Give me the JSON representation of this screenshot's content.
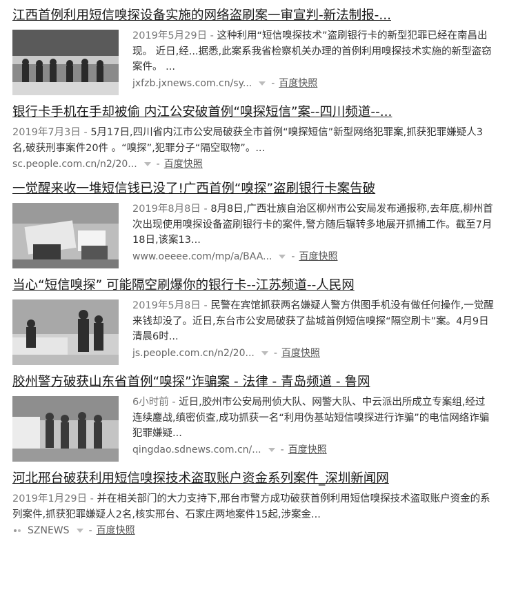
{
  "results": [
    {
      "title": "江西首例利用短信嗅探设备实施的网络盗刷案一审宣判-新法制报-...",
      "date": "2019年5月29日",
      "abstract": "这种利用“短信嗅探技术”盗刷银行卡的新型犯罪已经在南昌出现。 近日,经...据悉,此案系我省检察机关办理的首例利用嗅探技术实施的新型盗窃案件。 ...",
      "source": "jxfzb.jxnews.com.cn/sy...",
      "snapshot": "百度快照",
      "has_thumb": true
    },
    {
      "title": "银行卡手机在手却被偷 内江公安破首例“嗅探短信”案--四川频道--...",
      "date": "2019年7月3日",
      "abstract": "5月17日,四川省内江市公安局破获全市首例“嗅探短信”新型网络犯罪案,抓获犯罪嫌疑人3名,破获刑事案件20件 。“嗅探”,犯罪分子“隔空取物”。...",
      "source": "sc.people.com.cn/n2/20...",
      "snapshot": "百度快照",
      "has_thumb": false
    },
    {
      "title": "一觉醒来收一堆短信钱已没了!广西首例“嗅探”盗刷银行卡案告破",
      "date": "2019年8月8日",
      "abstract": "8月8日,广西壮族自治区柳州市公安局发布通报称,去年底,柳州首次出现使用嗅探设备盗刷银行卡的案件,警方随后辗转多地展开抓捕工作。截至7月18日,该案13...",
      "source": "www.oeeee.com/mp/a/BAA...",
      "snapshot": "百度快照",
      "has_thumb": true
    },
    {
      "title": "当心“短信嗅探” 可能隔空刷爆你的银行卡--江苏频道--人民网",
      "date": "2019年5月8日",
      "abstract": "民警在宾馆抓获两名嫌疑人警方供图手机没有做任何操作,一觉醒来钱却没了。近日,东台市公安局破获了盐城首例短信嗅探“隔空刷卡”案。4月9日清晨6时...",
      "source": "js.people.com.cn/n2/20...",
      "snapshot": "百度快照",
      "has_thumb": true
    },
    {
      "title": "胶州警方破获山东省首例“嗅探”诈骗案 - 法律 - 青岛频道 - 鲁网",
      "date": "6小时前",
      "abstract": "近日,胶州市公安局刑侦大队、网警大队、中云派出所成立专案组,经过连续鏖战,缜密侦查,成功抓获一名“利用伪基站短信嗅探进行诈骗”的电信网络诈骗犯罪嫌疑...",
      "source": "qingdao.sdnews.com.cn/...",
      "snapshot": "百度快照",
      "has_thumb": true
    },
    {
      "title": "河北邢台破获利用短信嗅探技术盗取账户资金系列案件_深圳新闻网",
      "date": "2019年1月29日",
      "abstract": "并在相关部门的大力支持下,邢台市警方成功破获首例利用短信嗅探技术盗取账户资金的系列案件,抓获犯罪嫌疑人2名,核实邢台、石家庄两地案件15起,涉案金...",
      "source": "SZNEWS",
      "snapshot": "百度快照",
      "has_thumb": false
    }
  ],
  "separator": " - ",
  "colors": {
    "title": "#1a1a1a",
    "text": "#333333",
    "meta": "#777777"
  },
  "icons": [
    "dropdown-caret-icon",
    "sznews-logo-icon"
  ]
}
